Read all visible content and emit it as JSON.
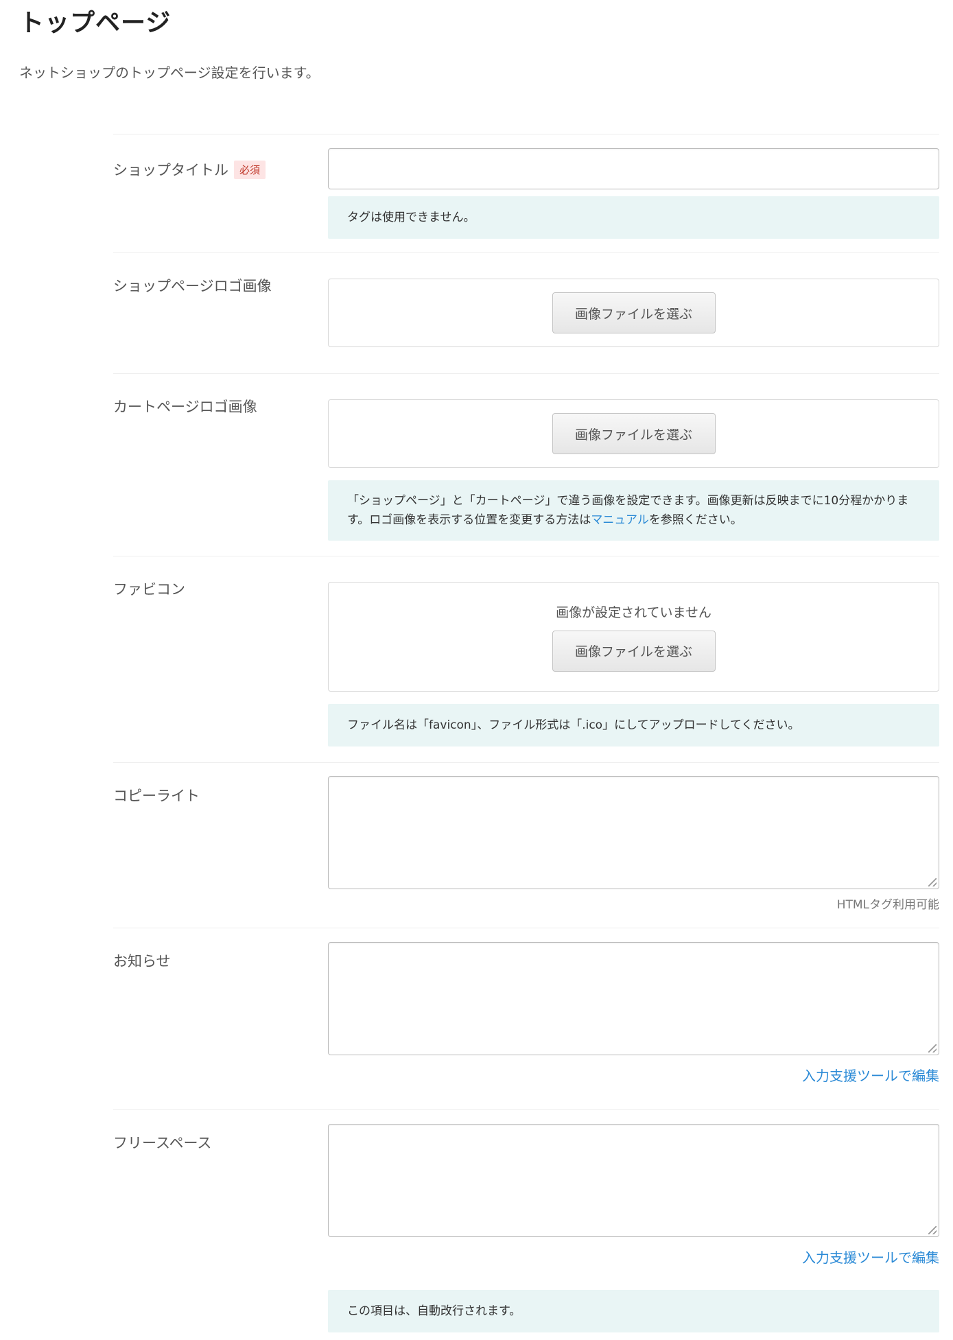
{
  "page": {
    "title": "トップページ",
    "description": "ネットショップのトップページ設定を行います。"
  },
  "fields": {
    "shop_title": {
      "label": "ショップタイトル",
      "required_badge": "必須",
      "value": "",
      "note": "タグは使用できません。"
    },
    "shop_logo": {
      "label": "ショップページロゴ画像",
      "button": "画像ファイルを選ぶ"
    },
    "cart_logo": {
      "label": "カートページロゴ画像",
      "button": "画像ファイルを選ぶ",
      "note_before": "「ショップページ」と「カートページ」で違う画像を設定できます。画像更新は反映までに10分程かかります。ロゴ画像を表示する位置を変更する方法は",
      "note_link": "マニュアル",
      "note_after": "を参照ください。"
    },
    "favicon": {
      "label": "ファビコン",
      "status": "画像が設定されていません",
      "button": "画像ファイルを選ぶ",
      "note": "ファイル名は「favicon」、ファイル形式は「.ico」にしてアップロードしてください。"
    },
    "copyright": {
      "label": "コピーライト",
      "value": "",
      "sub_note": "HTMLタグ利用可能"
    },
    "notice": {
      "label": "お知らせ",
      "value": "",
      "helper_link": "入力支援ツールで編集"
    },
    "free_space": {
      "label": "フリースペース",
      "value": "",
      "helper_link": "入力支援ツールで編集",
      "note": "この項目は、自動改行されます。"
    }
  }
}
